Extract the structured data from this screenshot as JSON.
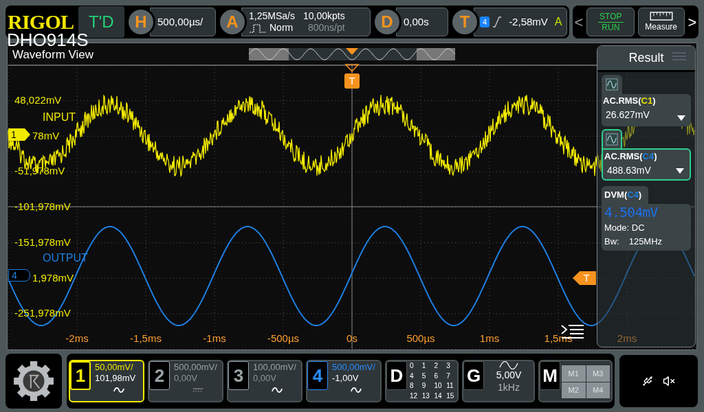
{
  "brand": {
    "logo": "RIGOL",
    "model": "DHO914S",
    "status": "T'D"
  },
  "top_bar": {
    "horizontal": {
      "label": "H",
      "scale": "500,00µs/"
    },
    "acquire": {
      "label": "A",
      "sample_rate": "1,25MSa/s",
      "mode": "Norm",
      "memory_depth": "10,00kpts",
      "resolution": "800ns/pt"
    },
    "delay": {
      "label": "D",
      "value": "0,00s"
    },
    "trigger": {
      "label": "T",
      "source": "4",
      "level": "-2,58mV",
      "sweep": "A"
    }
  },
  "toolbar": {
    "prev": "<",
    "run_stop": {
      "top": "STOP",
      "bottom": "RUN"
    },
    "measure": "Measure",
    "next": ">"
  },
  "waveform_view": {
    "title": "Waveform View",
    "y_labels": [
      {
        "text": "48,022mV",
        "behind_marker": false
      },
      {
        "text": "78mV",
        "behind_marker": true
      },
      {
        "text": "-51,978mV",
        "behind_marker": false
      },
      {
        "text": "-101,978mV",
        "behind_marker": false
      },
      {
        "text": "-151,978mV",
        "behind_marker": false
      },
      {
        "text": "1,978mV",
        "behind_marker": true
      },
      {
        "text": "-251,978mV",
        "behind_marker": false
      }
    ],
    "x_labels": [
      "-2ms",
      "-1,5ms",
      "-1ms",
      "-500µs",
      "0s",
      "500µs",
      "1ms",
      "1,5ms",
      "2ms"
    ],
    "traces": [
      {
        "label": "INPUT",
        "marker": "1",
        "color": "#f2ea00",
        "kind": "noisy"
      },
      {
        "label": "OUTPUT",
        "marker": "4",
        "color": "#1e7fe0",
        "kind": "clean"
      }
    ],
    "trigger_marker": "T",
    "level_marker": "T"
  },
  "result_panel": {
    "title": "Result",
    "measurements": [
      {
        "label_before": "AC.RMS(",
        "source": {
          "text": "C1",
          "color": "#e8e000"
        },
        "label_after": ")",
        "value": "26.627mV",
        "selected": false
      },
      {
        "label_before": "AC.RMS(",
        "source": {
          "text": "C4",
          "color": "#1e7fe0"
        },
        "label_after": ")",
        "value": "488.63mV",
        "selected": true
      }
    ],
    "dvm": {
      "label_before": "DVM(",
      "source": {
        "text": "C4",
        "color": "#1e7fe0"
      },
      "label_after": ")",
      "reading": "4.504mV",
      "mode": "Mode: DC",
      "bandwidth_label": "Bw:",
      "bandwidth": "125MHz"
    }
  },
  "channels": [
    {
      "number": "1",
      "scale": "50,00mV/",
      "offset": "101,98mV",
      "coupling": {
        "kind": "ac"
      },
      "color": "#f2ea00",
      "enabled": true,
      "selected": true
    },
    {
      "number": "2",
      "scale": "500,00mV/",
      "offset": "0,00V",
      "coupling": {
        "kind": "dc"
      },
      "color": "#9aa3a6",
      "enabled": false,
      "selected": false
    },
    {
      "number": "3",
      "scale": "100,00mV/",
      "offset": "0,00V",
      "coupling": {
        "kind": "ac"
      },
      "color": "#9aa3a6",
      "enabled": false,
      "selected": false
    },
    {
      "number": "4",
      "scale": "500,00mV/",
      "offset": "-1,00V",
      "coupling": {
        "kind": "ac"
      },
      "color": "#2a8cff",
      "enabled": true,
      "selected": false
    }
  ],
  "digital": {
    "label": "D",
    "bits": [
      "0",
      "1",
      "2",
      "3",
      "4",
      "5",
      "6",
      "7",
      "8",
      "9",
      "10",
      "11",
      "12",
      "13",
      "14",
      "15"
    ]
  },
  "generator": {
    "label": "G",
    "amplitude": "5,00V",
    "frequency": "1kHz"
  },
  "math": {
    "label": "M",
    "slots": [
      "M1",
      "M3",
      "M2",
      "M4"
    ]
  }
}
